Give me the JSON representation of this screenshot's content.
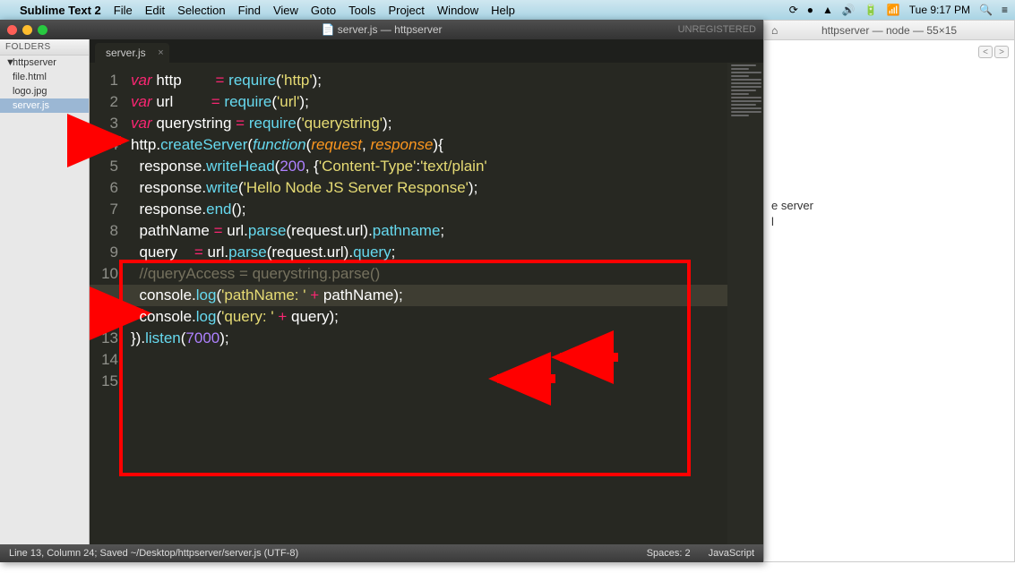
{
  "menubar": {
    "app": "Sublime Text 2",
    "items": [
      "File",
      "Edit",
      "Selection",
      "Find",
      "View",
      "Goto",
      "Tools",
      "Project",
      "Window",
      "Help"
    ],
    "clock": "Tue 9:17 PM"
  },
  "sublime": {
    "title": "server.js — httpserver",
    "title_icon": "📄",
    "unregistered": "UNREGISTERED",
    "sidebar": {
      "header": "FOLDERS",
      "project": "httpserver",
      "files": [
        "file.html",
        "logo.jpg",
        "server.js"
      ],
      "selected": "server.js"
    },
    "tab": {
      "label": "server.js"
    },
    "code": {
      "lines": [
        {
          "n": 1,
          "segs": [
            [
              "kw",
              "var"
            ],
            [
              "obj",
              " http        "
            ],
            [
              "op",
              "="
            ],
            [
              "obj",
              " "
            ],
            [
              "fn",
              "require"
            ],
            [
              "obj",
              "("
            ],
            [
              "str",
              "'http'"
            ],
            [
              "obj",
              ");"
            ]
          ]
        },
        {
          "n": 2,
          "segs": [
            [
              "kw",
              "var"
            ],
            [
              "obj",
              " url         "
            ],
            [
              "op",
              "="
            ],
            [
              "obj",
              " "
            ],
            [
              "fn",
              "require"
            ],
            [
              "obj",
              "("
            ],
            [
              "str",
              "'url'"
            ],
            [
              "obj",
              ");"
            ]
          ]
        },
        {
          "n": 3,
          "segs": [
            [
              "kw",
              "var"
            ],
            [
              "obj",
              " querystring "
            ],
            [
              "op",
              "="
            ],
            [
              "obj",
              " "
            ],
            [
              "fn",
              "require"
            ],
            [
              "obj",
              "("
            ],
            [
              "str",
              "'querystring'"
            ],
            [
              "obj",
              ");"
            ]
          ]
        },
        {
          "n": 4,
          "segs": [
            [
              "obj",
              ""
            ]
          ]
        },
        {
          "n": 5,
          "segs": [
            [
              "obj",
              "http."
            ],
            [
              "fn",
              "createServer"
            ],
            [
              "obj",
              "("
            ],
            [
              "kw2",
              "function"
            ],
            [
              "obj",
              "("
            ],
            [
              "arg",
              "request"
            ],
            [
              "obj",
              ", "
            ],
            [
              "arg",
              "response"
            ],
            [
              "obj",
              "){"
            ]
          ]
        },
        {
          "n": 6,
          "segs": [
            [
              "obj",
              "  response."
            ],
            [
              "fn",
              "writeHead"
            ],
            [
              "obj",
              "("
            ],
            [
              "num",
              "200"
            ],
            [
              "obj",
              ", {"
            ],
            [
              "str",
              "'Content-Type'"
            ],
            [
              "obj",
              ":"
            ],
            [
              "str",
              "'text/plain'"
            ]
          ]
        },
        {
          "n": 7,
          "segs": [
            [
              "obj",
              "  response."
            ],
            [
              "fn",
              "write"
            ],
            [
              "obj",
              "("
            ],
            [
              "str",
              "'Hello Node JS Server Response'"
            ],
            [
              "obj",
              ");"
            ]
          ]
        },
        {
          "n": 8,
          "segs": [
            [
              "obj",
              "  response."
            ],
            [
              "fn",
              "end"
            ],
            [
              "obj",
              "();"
            ]
          ]
        },
        {
          "n": 9,
          "segs": [
            [
              "obj",
              ""
            ]
          ]
        },
        {
          "n": 10,
          "segs": [
            [
              "obj",
              "  pathName "
            ],
            [
              "op",
              "="
            ],
            [
              "obj",
              " url."
            ],
            [
              "fn",
              "parse"
            ],
            [
              "obj",
              "(request.url)."
            ],
            [
              "prop",
              "pathname"
            ],
            [
              "obj",
              ";"
            ]
          ]
        },
        {
          "n": 11,
          "segs": [
            [
              "obj",
              "  query    "
            ],
            [
              "op",
              "="
            ],
            [
              "obj",
              " url."
            ],
            [
              "fn",
              "parse"
            ],
            [
              "obj",
              "(request.url)."
            ],
            [
              "prop",
              "query"
            ],
            [
              "obj",
              ";"
            ]
          ]
        },
        {
          "n": 12,
          "segs": [
            [
              "obj",
              "  "
            ],
            [
              "cm",
              "//queryAccess = querystring.parse()"
            ]
          ]
        },
        {
          "n": 13,
          "segs": [
            [
              "obj",
              "  console."
            ],
            [
              "fn",
              "log"
            ],
            [
              "obj",
              "("
            ],
            [
              "str",
              "'pathName: '"
            ],
            [
              "obj",
              " "
            ],
            [
              "op",
              "+"
            ],
            [
              "obj",
              " pathName);"
            ]
          ]
        },
        {
          "n": 14,
          "segs": [
            [
              "obj",
              "  console."
            ],
            [
              "fn",
              "log"
            ],
            [
              "obj",
              "("
            ],
            [
              "str",
              "'query: '"
            ],
            [
              "obj",
              " "
            ],
            [
              "op",
              "+"
            ],
            [
              "obj",
              " query);"
            ]
          ]
        },
        {
          "n": 15,
          "segs": [
            [
              "obj",
              "})."
            ],
            [
              "fn",
              "listen"
            ],
            [
              "obj",
              "("
            ],
            [
              "num",
              "7000"
            ],
            [
              "obj",
              ");"
            ]
          ]
        }
      ],
      "highlight_line": 13
    },
    "status": {
      "left": "Line 13, Column 24; Saved ~/Desktop/httpserver/server.js (UTF-8)",
      "spaces": "Spaces: 2",
      "lang": "JavaScript"
    }
  },
  "terminal": {
    "title": "httpserver — node — 55×15",
    "visible_lines": [
      "e server",
      "",
      "l"
    ]
  }
}
